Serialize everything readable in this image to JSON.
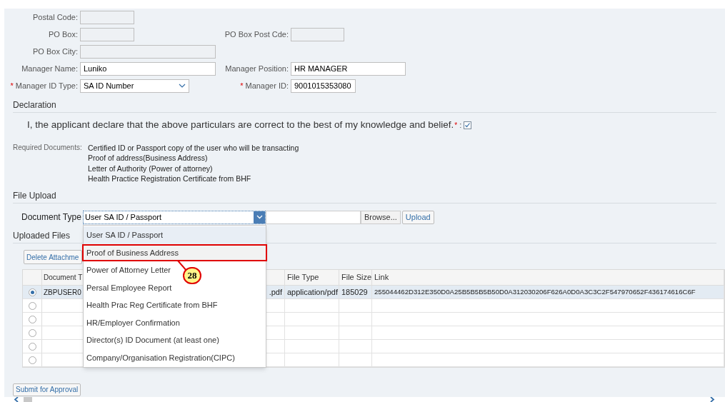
{
  "required_marker": "*",
  "form": {
    "rows": [
      {
        "left": {
          "label": "Postal Code:",
          "required": false,
          "disabled": true,
          "kind": "text"
        }
      },
      {
        "left": {
          "label": "PO Box:",
          "required": false,
          "disabled": true,
          "kind": "text"
        },
        "right": {
          "label": "PO Box Post Cde:",
          "required": false,
          "disabled": true,
          "kind": "text"
        }
      },
      {
        "left": {
          "label": "PO Box City:",
          "required": false,
          "disabled": true,
          "kind": "text"
        }
      },
      {
        "left": {
          "label": "Manager Name:",
          "value": "Luniko",
          "required": false,
          "disabled": false,
          "kind": "text"
        },
        "right": {
          "label": "Manager Position:",
          "value": "HR MANAGER",
          "required": false,
          "disabled": false,
          "kind": "text"
        }
      },
      {
        "left": {
          "label": "Manager ID Type:",
          "value": "SA ID Number",
          "required": true,
          "disabled": false,
          "kind": "select"
        },
        "right": {
          "label": "Manager ID:",
          "value": "9001015353080",
          "required": true,
          "disabled": false,
          "kind": "text"
        }
      }
    ]
  },
  "declaration": {
    "title": "Declaration",
    "statement": "I, the applicant declare that the above particulars are correct to the best of my knowledge and belief.",
    "required": true,
    "colon": ":",
    "checked": true
  },
  "required_documents": {
    "label": "Required Documents:",
    "items": [
      "Certified ID or Passport copy of the user who will be transacting",
      "Proof of address(Business Address)",
      "Letter of Authority (Power of attorney)",
      "Health Practice Registration Certificate from BHF"
    ]
  },
  "file_upload": {
    "title": "File Upload",
    "document_type_label": "Document Type",
    "document_type_value": "User SA ID / Passport",
    "browse": "Browse...",
    "upload": "Upload",
    "options": [
      {
        "label": "User SA ID / Passport",
        "selected": true,
        "annotated": false
      },
      {
        "label": "Proof of Business Address",
        "selected": false,
        "annotated": true
      },
      {
        "label": "Power of Attorney Letter",
        "selected": false,
        "annotated": false
      },
      {
        "label": "Persal Employee Report",
        "selected": false,
        "annotated": false
      },
      {
        "label": "Health Prac Reg Certificate from BHF",
        "selected": false,
        "annotated": false
      },
      {
        "label": "HR/Employer Confirmation",
        "selected": false,
        "annotated": false
      },
      {
        "label": "Director(s) ID Document (at least one)",
        "selected": false,
        "annotated": false
      },
      {
        "label": "Company/Organisation Registration(CIPC)",
        "selected": false,
        "annotated": false
      }
    ]
  },
  "callout": {
    "label": "28"
  },
  "uploaded_files": {
    "title": "Uploaded Files",
    "delete_button": "Delete Attachme",
    "columns": [
      "Document T",
      null,
      "File Type",
      "File Size",
      "Link"
    ],
    "rows": [
      {
        "selected": true,
        "cells": [
          "ZBPUSER0",
          ".pdf",
          "application/pdf",
          "185029",
          "255044462D312E350D0A25B5B5B5B50D0A312030206F626A0D0A3C3C2F547970652F436174616C6F"
        ]
      },
      {
        "selected": false,
        "cells": [
          null,
          null,
          null,
          null,
          null
        ]
      },
      {
        "selected": false,
        "cells": [
          null,
          null,
          null,
          null,
          null
        ]
      },
      {
        "selected": false,
        "cells": [
          null,
          null,
          null,
          null,
          null
        ]
      },
      {
        "selected": false,
        "cells": [
          null,
          null,
          null,
          null,
          null
        ]
      },
      {
        "selected": false,
        "cells": [
          null,
          null,
          null,
          null,
          null
        ]
      }
    ]
  },
  "submit_button": "Submit for Approval"
}
